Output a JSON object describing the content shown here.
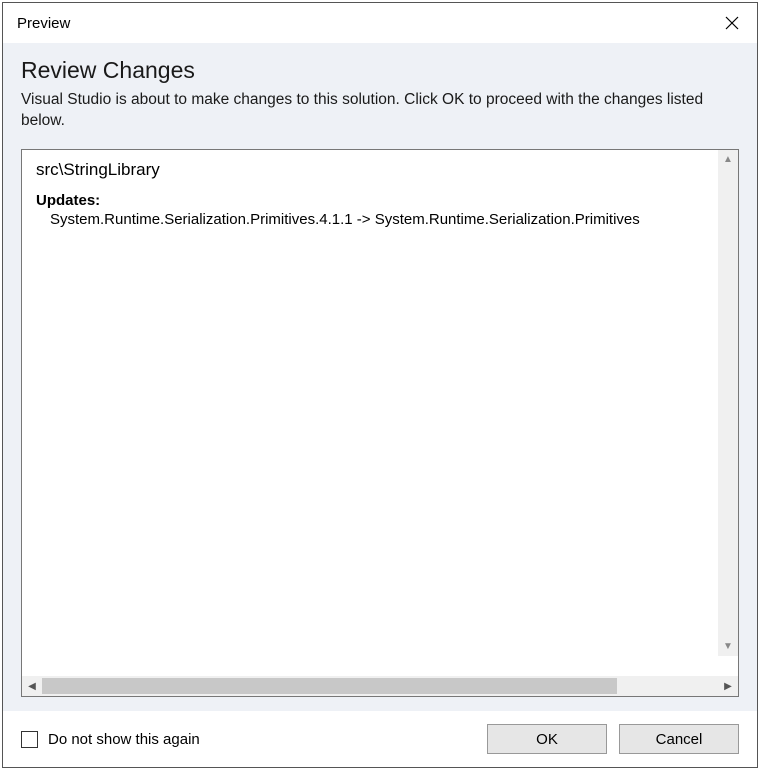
{
  "window": {
    "title": "Preview"
  },
  "header": {
    "title": "Review Changes",
    "description": "Visual Studio is about to make changes to this solution. Click OK to proceed with the changes listed below."
  },
  "content": {
    "project": "src\\StringLibrary",
    "updates_label": "Updates:",
    "updates": [
      "System.Runtime.Serialization.Primitives.4.1.1 -> System.Runtime.Serialization.Primitives"
    ]
  },
  "footer": {
    "checkbox_label": "Do not show this again",
    "ok_label": "OK",
    "cancel_label": "Cancel"
  }
}
